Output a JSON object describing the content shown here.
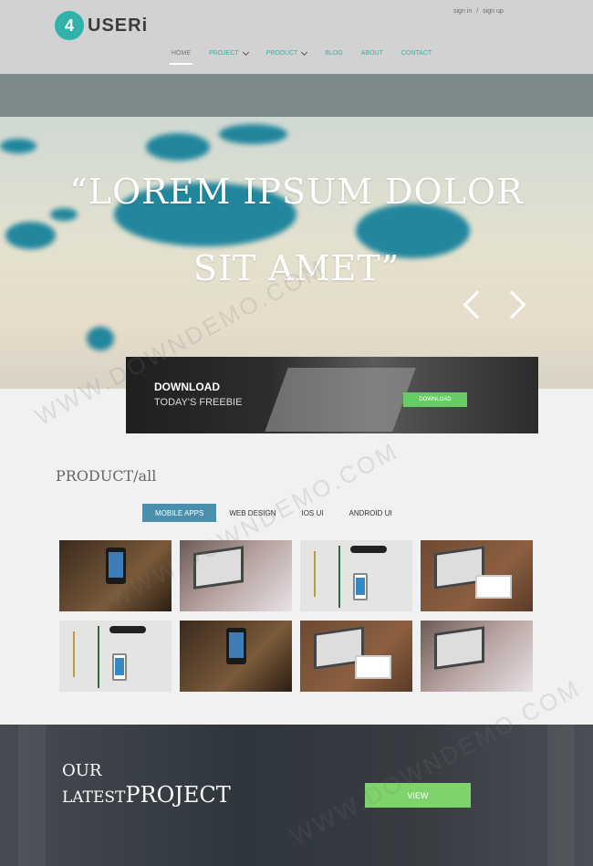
{
  "header": {
    "logo_badge": "4",
    "logo_text": "USERi",
    "auth": {
      "signin": "sign in",
      "separator": "/",
      "signup": "sign up"
    },
    "nav": [
      {
        "label": "HOME",
        "active": true,
        "dropdown": false
      },
      {
        "label": "PROJECT",
        "active": false,
        "dropdown": true
      },
      {
        "label": "PRODUCT",
        "active": false,
        "dropdown": true
      },
      {
        "label": "BLOG",
        "active": false,
        "dropdown": false
      },
      {
        "label": "ABOUT",
        "active": false,
        "dropdown": false
      },
      {
        "label": "CONTACT",
        "active": false,
        "dropdown": false
      }
    ]
  },
  "hero": {
    "line1": "“LOREM IPSUM DOLOR",
    "line2": "SIT AMET”"
  },
  "banner": {
    "title": "DOWNLOAD",
    "subtitle": "TODAY'S FREEBIE",
    "button": "DOWNLOAD"
  },
  "products": {
    "title": "PRODUCT/all",
    "filters": [
      "MOBILE APPS",
      "WEB DESIGN",
      "IOS UI",
      "ANDROID UI"
    ],
    "active_filter": "MOBILE APPS",
    "tiles": [
      "phone-in-hand",
      "laptop-typing",
      "glasses-and-phone",
      "laptop-and-tablet",
      "glasses-and-phone",
      "phone-in-hand",
      "laptop-and-tablet",
      "laptop-typing"
    ]
  },
  "project": {
    "line1": "OUR",
    "line2_small": "LATEST",
    "line2_big": "PROJECT",
    "button": "VIEW"
  },
  "watermark": "WWW.DOWNDEMO.COM",
  "colors": {
    "accent_teal": "#2fb3a9",
    "filter_active": "#4a8fab",
    "button_green": "#7fd36b"
  }
}
